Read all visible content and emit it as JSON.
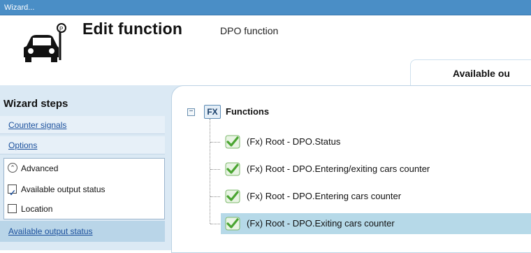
{
  "window": {
    "title": "Wizard..."
  },
  "header": {
    "title": "Edit function",
    "subtitle": "DPO function",
    "tab_label": "Available ou",
    "icon": "parking-car-icon"
  },
  "sidebar": {
    "title": "Wizard steps",
    "steps": [
      {
        "label": "Counter signals"
      },
      {
        "label": "Options"
      }
    ],
    "advanced": {
      "label": "Advanced",
      "options": [
        {
          "label": "Available output status",
          "checked": true
        },
        {
          "label": "Location",
          "checked": false
        }
      ]
    },
    "active_step": {
      "label": "Available output status"
    }
  },
  "tree": {
    "root_badge": "FX",
    "root_label": "Functions",
    "items": [
      {
        "label": "(Fx) Root - DPO.Status",
        "checked": true,
        "selected": false
      },
      {
        "label": "(Fx) Root - DPO.Entering/exiting cars counter",
        "checked": true,
        "selected": false
      },
      {
        "label": "(Fx) Root - DPO.Entering cars counter",
        "checked": true,
        "selected": false
      },
      {
        "label": "(Fx) Root - DPO.Exiting cars counter",
        "checked": true,
        "selected": true
      }
    ]
  },
  "colors": {
    "titlebar": "#4a8ec6",
    "panel_bg": "#dbe9f4",
    "selection": "#b6d9e8",
    "link": "#1a4f9c",
    "check_green": "#5ab53a"
  }
}
